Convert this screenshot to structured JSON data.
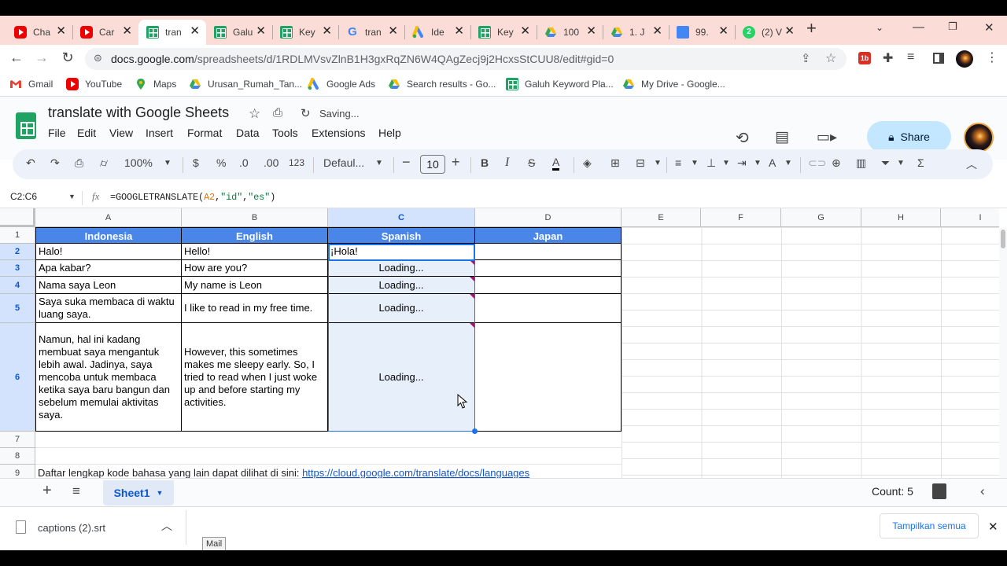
{
  "browser": {
    "tabs": [
      {
        "label": "Cha",
        "icon": "youtube-icon",
        "active": false
      },
      {
        "label": "Car",
        "icon": "youtube-icon",
        "active": false
      },
      {
        "label": "tran",
        "icon": "sheets-icon",
        "active": true
      },
      {
        "label": "Galu",
        "icon": "sheets-icon",
        "active": false
      },
      {
        "label": "Key",
        "icon": "sheets-icon",
        "active": false
      },
      {
        "label": "tran",
        "icon": "google-icon",
        "active": false
      },
      {
        "label": "Ide",
        "icon": "google-ads-icon",
        "active": false
      },
      {
        "label": "Key",
        "icon": "sheets-icon",
        "active": false
      },
      {
        "label": "100",
        "icon": "google-drive-icon",
        "active": false
      },
      {
        "label": "1. J",
        "icon": "google-drive-icon",
        "active": false
      },
      {
        "label": "99.",
        "icon": "docs-icon",
        "active": false
      },
      {
        "label": "(2) V",
        "icon": "whatsapp-icon",
        "active": false
      }
    ],
    "url_host": "docs.google.com",
    "url_path": "/spreadsheets/d/1RDLMVsvZlnB1H3gxRqZN6W4QAgZecj9j2HcxsStCUU8/edit#gid=0",
    "bookmarks": [
      {
        "label": "Gmail",
        "icon": "gmail-icon"
      },
      {
        "label": "YouTube",
        "icon": "youtube-icon"
      },
      {
        "label": "Maps",
        "icon": "maps-icon"
      },
      {
        "label": "Urusan_Rumah_Tan...",
        "icon": "google-drive-icon"
      },
      {
        "label": "Google Ads",
        "icon": "google-ads-icon"
      },
      {
        "label": "Search results - Go...",
        "icon": "google-drive-icon"
      },
      {
        "label": "Galuh Keyword Pla...",
        "icon": "sheets-icon"
      },
      {
        "label": "My Drive - Google...",
        "icon": "google-drive-icon"
      }
    ]
  },
  "doc": {
    "title": "translate with Google Sheets",
    "save_status": "Saving...",
    "menus": [
      "File",
      "Edit",
      "View",
      "Insert",
      "Format",
      "Data",
      "Tools",
      "Extensions",
      "Help"
    ],
    "share_label": "Share"
  },
  "toolbar": {
    "zoom": "100%",
    "currency": "$",
    "percent": "%",
    "dec_decrease": ".0",
    "dec_increase": ".00",
    "number_format": "123",
    "font": "Defaul...",
    "font_size": "10"
  },
  "formula_bar": {
    "name_box": "C2:C6",
    "fx": "fx",
    "formula_prefix": "=GOOGLETRANSLATE(",
    "formula_ref": "A2",
    "formula_sep1": ",",
    "formula_arg2": "\"id\"",
    "formula_sep2": ",",
    "formula_arg3": "\"es\"",
    "formula_suffix": ")"
  },
  "grid": {
    "columns": [
      "A",
      "B",
      "C",
      "D",
      "E",
      "F",
      "G",
      "H",
      "I"
    ],
    "rows": [
      "1",
      "2",
      "3",
      "4",
      "5",
      "6",
      "7",
      "8",
      "9"
    ],
    "header": [
      "Indonesia",
      "English",
      "Spanish",
      "Japan"
    ],
    "data": [
      [
        "Halo!",
        "Hello!",
        "¡Hola!",
        ""
      ],
      [
        "Apa kabar?",
        "How are you?",
        "Loading...",
        ""
      ],
      [
        "Nama saya Leon",
        "My name is Leon",
        "Loading...",
        ""
      ],
      [
        "Saya suka membaca di waktu luang saya.",
        "I like to read in my free time.",
        "Loading...",
        ""
      ],
      [
        "Namun, hal ini kadang membuat saya mengantuk lebih awal. Jadinya, saya mencoba untuk membaca ketika saya baru bangun dan sebelum memulai aktivitas saya.",
        "However, this sometimes makes me sleepy early. So, I tried to read when I just woke up and before starting my activities.",
        "Loading...",
        ""
      ]
    ],
    "note_text": "Daftar lengkap kode bahasa yang lain dapat dilihat di sini: ",
    "note_link": "https://cloud.google.com/translate/docs/languages"
  },
  "sheets": {
    "active_sheet": "Sheet1",
    "count": "Count: 5"
  },
  "downloads": {
    "file": "captions (2).srt",
    "show_all": "Tampilkan semua",
    "tooltip": "Mail"
  }
}
